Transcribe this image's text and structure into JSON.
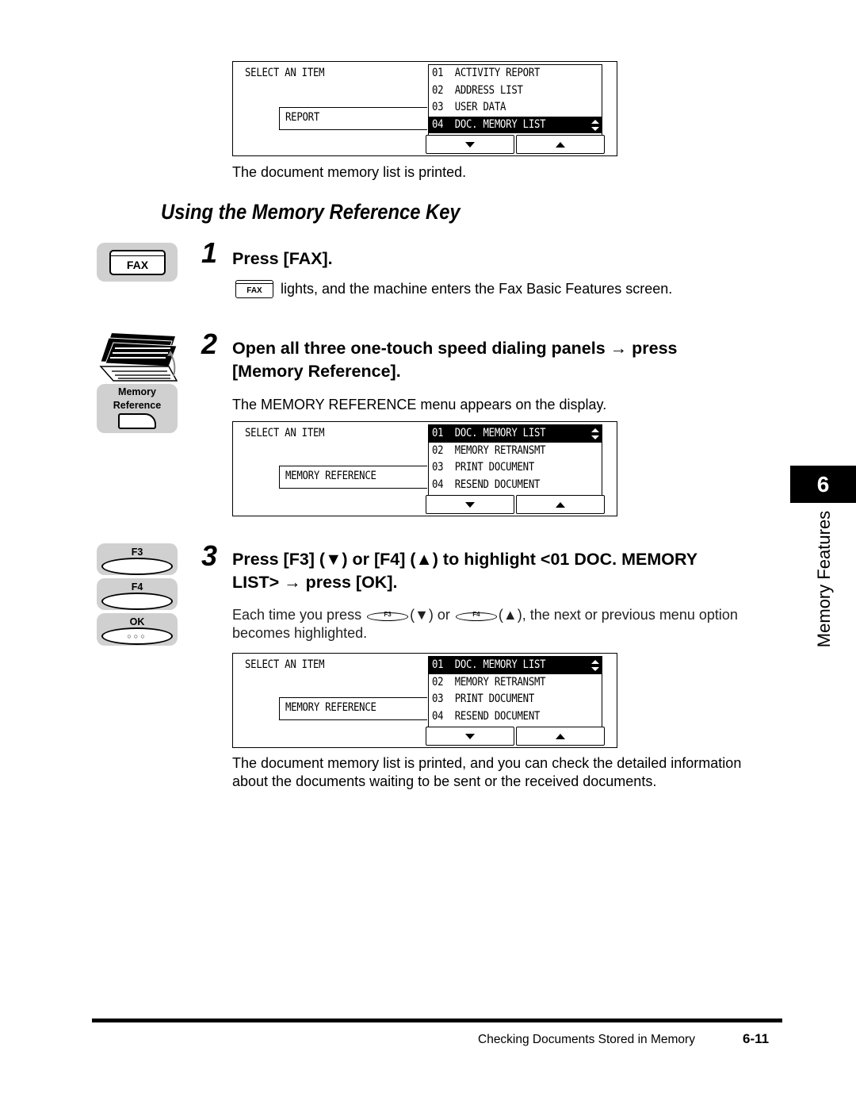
{
  "lcd_top": {
    "title": "SELECT AN ITEM",
    "selected_category": "REPORT",
    "menu_items": [
      {
        "num": "01",
        "label": "ACTIVITY REPORT",
        "highlighted": false
      },
      {
        "num": "02",
        "label": "ADDRESS LIST",
        "highlighted": false
      },
      {
        "num": "03",
        "label": "USER DATA",
        "highlighted": false
      },
      {
        "num": "04",
        "label": "DOC. MEMORY LIST",
        "highlighted": true
      }
    ],
    "down_button_icon": "triangle-down-icon",
    "up_button_icon": "triangle-up-icon"
  },
  "caption_top": "The document memory list is printed.",
  "section_title": "Using the Memory Reference Key",
  "steps": [
    {
      "number": "1",
      "heading": "Press [FAX].",
      "key_label": "FAX",
      "inline_key_label": "FAX",
      "description": "lights, and the machine enters the Fax Basic Features screen."
    },
    {
      "number": "2",
      "heading_line1": "Open all three one-touch speed dialing panels → press",
      "heading_line2": "[Memory Reference].",
      "key_label_line1": "Memory",
      "key_label_line2": "Reference",
      "description": "The MEMORY REFERENCE menu appears on the display.",
      "lcd": {
        "title": "SELECT AN ITEM",
        "selected_category": "MEMORY REFERENCE",
        "menu_items": [
          {
            "num": "01",
            "label": "DOC. MEMORY LIST",
            "highlighted": true
          },
          {
            "num": "02",
            "label": "MEMORY RETRANSMT",
            "highlighted": false
          },
          {
            "num": "03",
            "label": "PRINT DOCUMENT",
            "highlighted": false
          },
          {
            "num": "04",
            "label": "RESEND DOCUMENT",
            "highlighted": false
          }
        ]
      }
    },
    {
      "number": "3",
      "heading_line1": "Press [F3] (▼) or [F4] (▲) to highlight <01 DOC. MEMORY",
      "heading_line2": "LIST> → press [OK].",
      "keys": [
        "F3",
        "F4",
        "OK"
      ],
      "desc_part1": "Each time you press",
      "desc_key1": "F3",
      "desc_part2": "(▼) or",
      "desc_key2": "F4",
      "desc_part3": "(▲), the next or previous menu option",
      "desc_line2": "becomes highlighted.",
      "lcd": {
        "title": "SELECT AN ITEM",
        "selected_category": "MEMORY REFERENCE",
        "menu_items": [
          {
            "num": "01",
            "label": "DOC. MEMORY LIST",
            "highlighted": true
          },
          {
            "num": "02",
            "label": "MEMORY RETRANSMT",
            "highlighted": false
          },
          {
            "num": "03",
            "label": "PRINT DOCUMENT",
            "highlighted": false
          },
          {
            "num": "04",
            "label": "RESEND DOCUMENT",
            "highlighted": false
          }
        ]
      },
      "result_line1": "The document memory list is printed, and you can check the detailed information",
      "result_line2": "about the documents waiting to be sent or the received documents."
    }
  ],
  "chapter_tab": {
    "number": "6",
    "label": "Memory Features"
  },
  "footer": {
    "section": "Checking Documents Stored in Memory",
    "page": "6-11"
  }
}
